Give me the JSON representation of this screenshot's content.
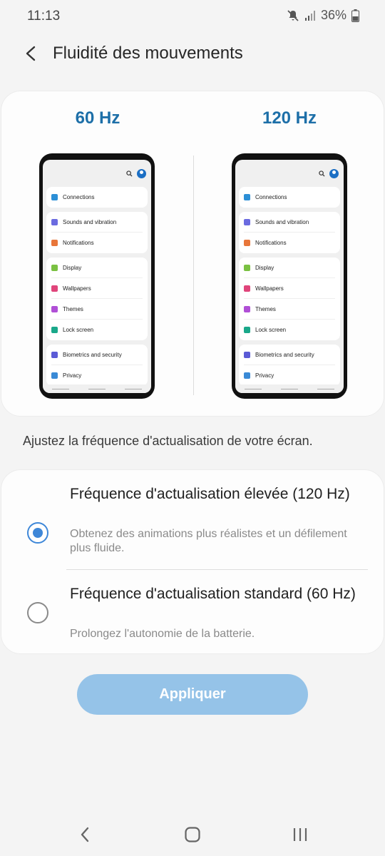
{
  "status_bar": {
    "time": "11:13",
    "battery": "36%"
  },
  "header": {
    "title": "Fluidité des mouvements"
  },
  "preview": {
    "left_label": "60 Hz",
    "right_label": "120 Hz",
    "menu_groups": [
      [
        {
          "label": "Connections",
          "color": "#2c8fd6"
        }
      ],
      [
        {
          "label": "Sounds and vibration",
          "color": "#6b6be0"
        },
        {
          "label": "Notifications",
          "color": "#e8763a"
        }
      ],
      [
        {
          "label": "Display",
          "color": "#7ac142"
        },
        {
          "label": "Wallpapers",
          "color": "#e0457b"
        },
        {
          "label": "Themes",
          "color": "#b04fd6"
        },
        {
          "label": "Lock screen",
          "color": "#1aa88a"
        }
      ],
      [
        {
          "label": "Biometrics and security",
          "color": "#5b5bd6"
        },
        {
          "label": "Privacy",
          "color": "#3a8ad6"
        }
      ]
    ]
  },
  "description": "Ajustez la fréquence d'actualisation de votre écran.",
  "options": [
    {
      "title": "Fréquence d'actualisation élevée (120 Hz)",
      "subtitle": "Obtenez des animations plus réalistes et un défilement plus fluide.",
      "selected": true
    },
    {
      "title": "Fréquence d'actualisation standard (60 Hz)",
      "subtitle": "Prolongez l'autonomie de la batterie.",
      "selected": false
    }
  ],
  "apply_label": "Appliquer",
  "colors": {
    "accent": "#3e87d8",
    "hz_label": "#1d6fa8",
    "apply_disabled": "#95c3e8"
  }
}
